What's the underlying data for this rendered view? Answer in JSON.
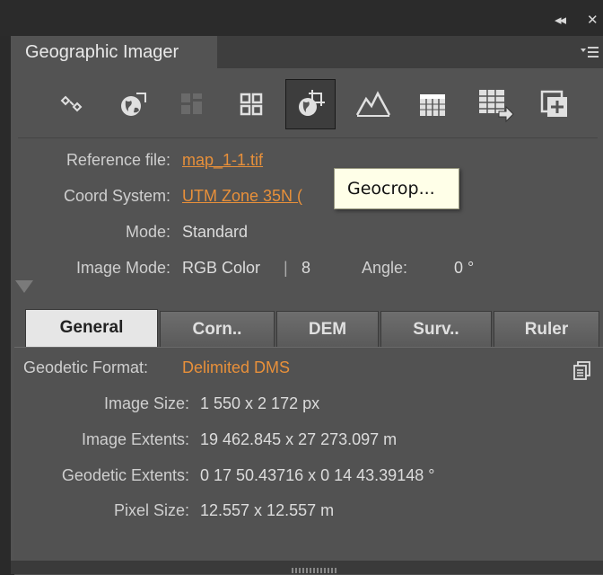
{
  "window": {
    "collapse_glyph": "◂◂",
    "close_glyph": "✕"
  },
  "panel": {
    "title": "Geographic Imager",
    "menu_icon": "panel-menu-icon"
  },
  "toolbar": {
    "tools": [
      {
        "name": "transform-icon"
      },
      {
        "name": "georeference-icon"
      },
      {
        "name": "mosaic-icon"
      },
      {
        "name": "tile-icon"
      },
      {
        "name": "geocrop-icon",
        "active": true
      },
      {
        "name": "terrain-icon"
      },
      {
        "name": "table-icon"
      },
      {
        "name": "export-grid-icon"
      },
      {
        "name": "add-layer-icon"
      }
    ]
  },
  "tooltip": "Geocrop...",
  "info": {
    "reference_label": "Reference file:",
    "reference_value": "map_1-1.tif",
    "coord_label": "Coord System:",
    "coord_value": "UTM Zone 35N (",
    "mode_label": "Mode:",
    "mode_value": "Standard",
    "image_mode_label": "Image Mode:",
    "image_mode_value": "RGB Color",
    "image_mode_sep": "|",
    "bit_depth": "8",
    "angle_label": "Angle:",
    "angle_value": "0 °"
  },
  "tabs": [
    "General",
    "Corn..",
    "DEM",
    "Surv..",
    "Ruler"
  ],
  "details": {
    "geodetic_format_label": "Geodetic Format:",
    "geodetic_format_value": "Delimited DMS",
    "image_size_label": "Image Size:",
    "image_size_value": "1 550 x 2 172 px",
    "image_extents_label": "Image Extents:",
    "image_extents_value": "19 462.845 x 27 273.097 m",
    "geodetic_extents_label": "Geodetic Extents:",
    "geodetic_extents_value": "0 17 50.43716 x 0 14 43.39148 °",
    "pixel_size_label": "Pixel Size:",
    "pixel_size_value": "12.557 x 12.557 m"
  },
  "colors": {
    "accent": "#e8903a",
    "panel_bg": "#535353",
    "tooltip_bg": "#ffffe8"
  }
}
